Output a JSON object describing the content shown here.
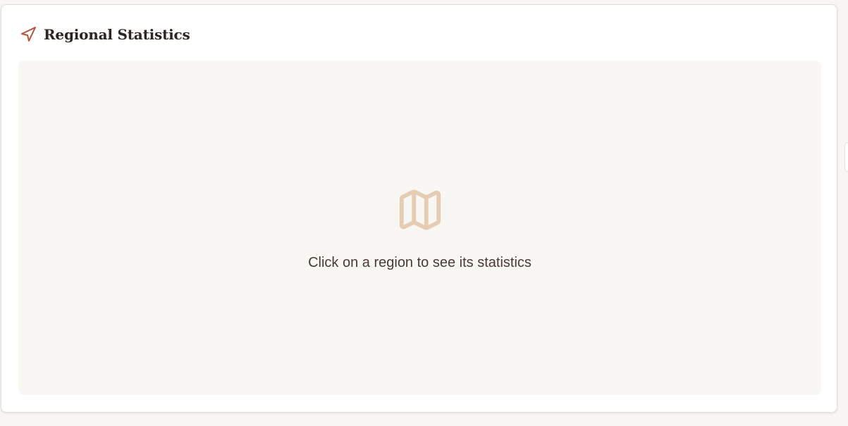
{
  "card": {
    "title": "Regional Statistics",
    "header_icon": "navigation-arrow-icon"
  },
  "empty_state": {
    "icon": "map-icon",
    "message": "Click on a region to see its statistics"
  },
  "colors": {
    "accent": "#b5533c",
    "map_icon": "#e6ccb2",
    "panel_background": "#f9f7f4",
    "title_text": "#2b2622",
    "message_text": "#4a3a34"
  }
}
